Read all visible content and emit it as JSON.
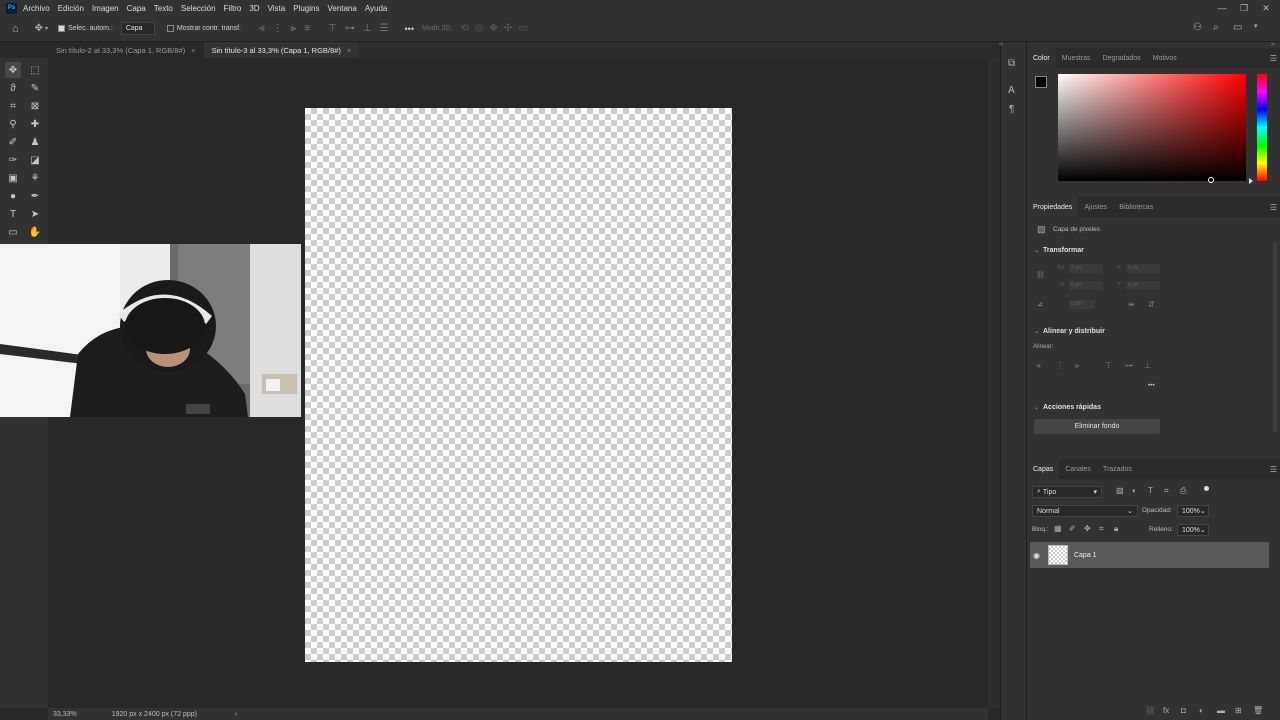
{
  "menubar": {
    "logo": "Ps",
    "items": [
      "Archivo",
      "Edición",
      "Imagen",
      "Capa",
      "Texto",
      "Selección",
      "Filtro",
      "3D",
      "Vista",
      "Plugins",
      "Ventana",
      "Ayuda"
    ],
    "window_controls": [
      "—",
      "❐",
      "✕"
    ]
  },
  "options": {
    "auto_select_label": "Selec. autom.:",
    "auto_select_checked": true,
    "layer_select": "Capa",
    "show_transform_label": "Mostrar contr. transf.",
    "show_transform_checked": false,
    "more": "•••",
    "mode3d_label": "Modo 3D:"
  },
  "tabs": [
    {
      "label": "Sin título-2 al 33,3% (Capa 1, RGB/8#)",
      "active": false,
      "close": "×"
    },
    {
      "label": "Sin título-3 al 33,3% (Capa 1, RGB/8#)",
      "active": true,
      "close": "×"
    }
  ],
  "status": {
    "zoom": "33,33%",
    "doc_info": "1920 px x 2400 px (72 ppp)",
    "arrow": "›"
  },
  "color_panel": {
    "tabs": [
      "Color",
      "Muestras",
      "Degradados",
      "Motivos"
    ],
    "active_tab": "Color",
    "foreground": "#000000",
    "background": "#ffffff",
    "hue_color": "#ff0000"
  },
  "properties_panel": {
    "tabs": [
      "Propiedades",
      "Ajustes",
      "Bibliotecas"
    ],
    "active_tab": "Propiedades",
    "layer_type": "Capa de píxeles",
    "transform_title": "Transformar",
    "an_label": "An",
    "an_value": "0 px",
    "x_label": "X",
    "x_value": "0 px",
    "al_label": "Al",
    "al_value": "0 px",
    "y_label": "Y",
    "y_value": "0 px",
    "angle_value": "0,00°",
    "align_title": "Alinear y distribuir",
    "align_label": "Alinear:",
    "more": "•••",
    "quick_actions_title": "Acciones rápidas",
    "remove_bg_button": "Eliminar fondo"
  },
  "layers_panel": {
    "tabs": [
      "Capas",
      "Canales",
      "Trazados"
    ],
    "active_tab": "Capas",
    "filter_kind": "Tipo",
    "blend_mode": "Normal",
    "opacity_label": "Opacidad:",
    "opacity_value": "100%",
    "lock_label": "Bloq.:",
    "fill_label": "Relleno:",
    "fill_value": "100%",
    "layers": [
      {
        "name": "Capa 1",
        "visible": true,
        "selected": true
      }
    ]
  }
}
